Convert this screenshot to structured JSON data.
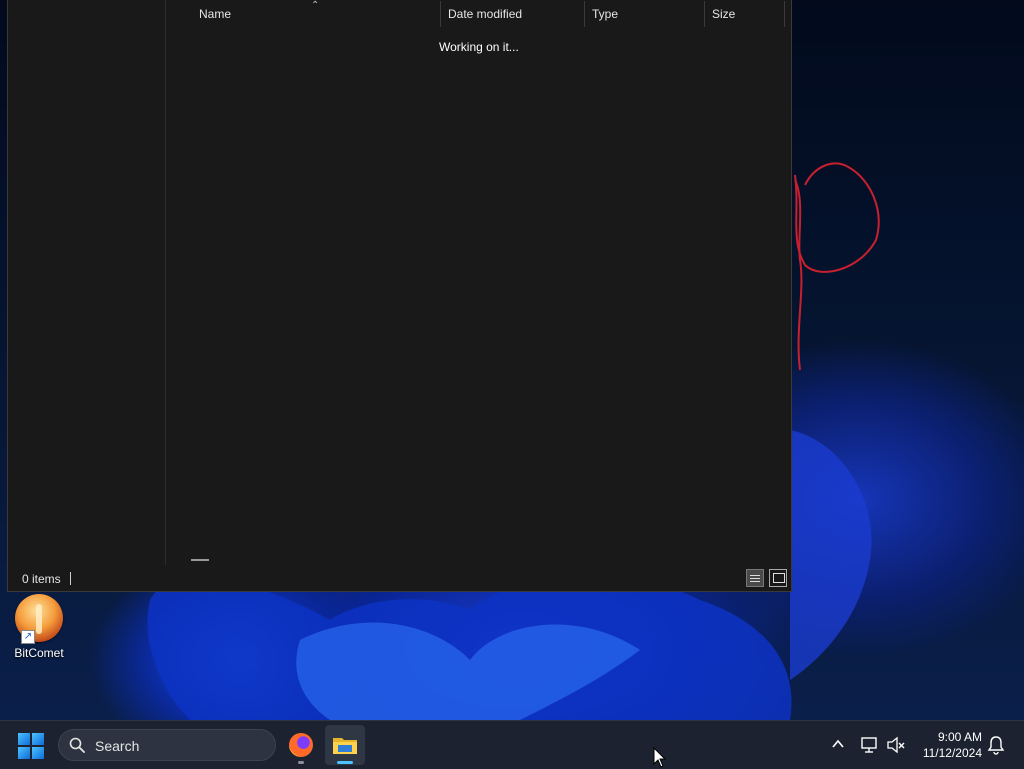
{
  "explorer": {
    "columns": {
      "name": "Name",
      "date_modified": "Date modified",
      "type": "Type",
      "size": "Size"
    },
    "status_message": "Working on it...",
    "status_bar": {
      "item_count": "0 items"
    },
    "views": {
      "active": "details",
      "available": [
        "details",
        "large-icons"
      ]
    }
  },
  "desktop": {
    "icons": [
      {
        "label": "BitComet",
        "icon": "bitcomet-icon",
        "shortcut": true
      }
    ]
  },
  "taskbar": {
    "search_placeholder": "Search",
    "pinned_apps": [
      {
        "name": "firefox",
        "icon": "firefox-icon",
        "running": true
      },
      {
        "name": "file-explorer",
        "icon": "folder-icon",
        "running": true,
        "active": true
      }
    ],
    "clock": {
      "time": "9:00 AM",
      "date": "11/12/2024"
    },
    "accent_color": "#4cc2ff"
  }
}
